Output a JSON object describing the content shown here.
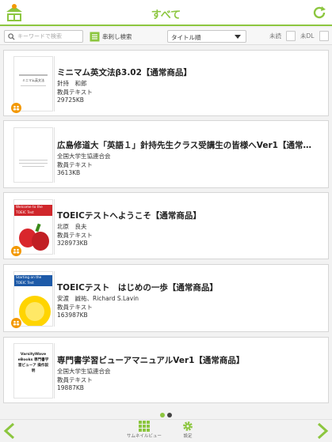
{
  "header": {
    "title": "すべて"
  },
  "toolbar": {
    "search_placeholder": "キーワードで検索",
    "handwriting_search_label": "串刺し検索",
    "sort_selected": "タイトル順",
    "unread_label": "未読",
    "not_downloaded_label": "未DL"
  },
  "books": [
    {
      "title": "ミニマム英文法β3.02【通常商品】",
      "author": "針持　和郎",
      "category": "教員テキスト",
      "size": "29725KB",
      "cover_text": "ミニマム英文法"
    },
    {
      "title": "広島修道大「英語１」針持先生クラス受講生の皆様へVer1【通常…",
      "author": "全国大学生協連合会",
      "category": "教員テキスト",
      "size": "3613KB",
      "cover_text": ""
    },
    {
      "title": "TOEICテストへようこそ【通常商品】",
      "author": "北原　良夫",
      "category": "教員テキスト",
      "size": "328973KB",
      "cover_text": "Welcome to the TOEIC Test"
    },
    {
      "title": "TOEICテスト　はじめの一歩【通常商品】",
      "author": "安渡　誠祐、Richard S.Lavin",
      "category": "教員テキスト",
      "size": "163987KB",
      "cover_text": "Starting on the TOEIC Test"
    },
    {
      "title": "専門書学習ビューアマニュアルVer1【通常商品】",
      "author": "全国大学生協連合会",
      "category": "教員テキスト",
      "size": "19887KB",
      "cover_text": "VarsityWave eBooks 専門書学習ビューア 操作説明"
    }
  ],
  "bottom": {
    "thumbnail_label": "サムネイルビュー",
    "settings_label": "設定"
  },
  "colors": {
    "accent": "#8cc63f",
    "badge": "#f39800"
  }
}
